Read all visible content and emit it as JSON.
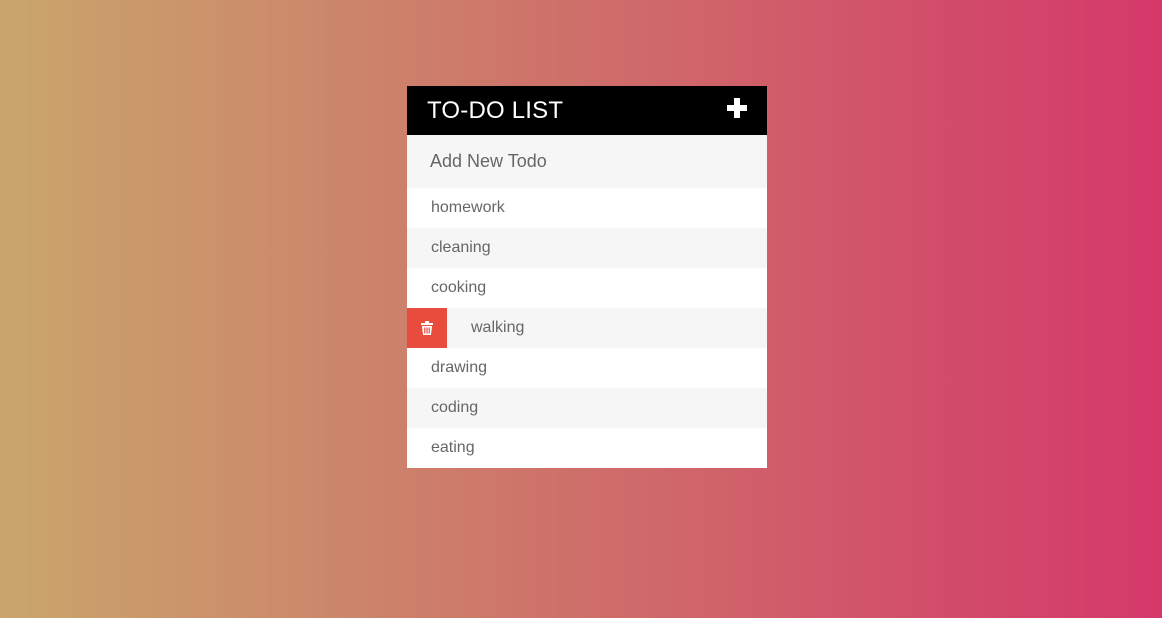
{
  "header": {
    "title": "TO-DO LIST",
    "add_icon": "plus-icon"
  },
  "new_todo": {
    "placeholder": "Add New Todo",
    "value": ""
  },
  "todos": [
    {
      "text": "homework",
      "hovered": false
    },
    {
      "text": "cleaning",
      "hovered": false
    },
    {
      "text": "cooking",
      "hovered": false
    },
    {
      "text": "walking",
      "hovered": true,
      "delete_icon": "trash-icon"
    },
    {
      "text": "drawing",
      "hovered": false
    },
    {
      "text": "coding",
      "hovered": false
    },
    {
      "text": "eating",
      "hovered": false
    }
  ],
  "colors": {
    "background_gradient": [
      "#c9a66b",
      "#d4386a"
    ],
    "header_background": "#000000",
    "delete_button": "#e74c3c",
    "item_text": "#666666"
  }
}
